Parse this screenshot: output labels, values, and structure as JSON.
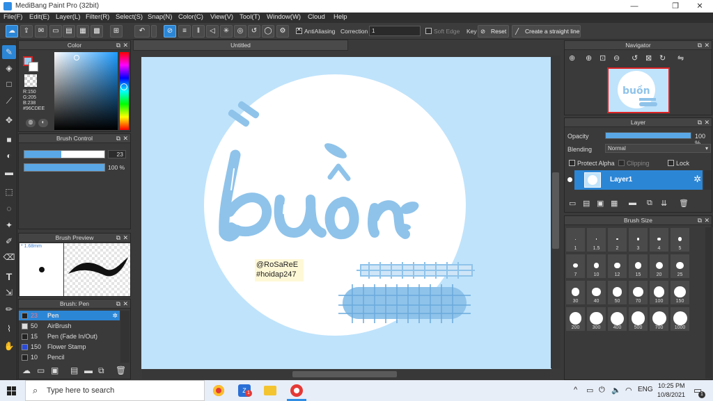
{
  "window": {
    "title": "MediBang Paint Pro (32bit)",
    "minimize": "—",
    "restore": "❐",
    "close": "✕"
  },
  "menu": [
    "File(F)",
    "Edit(E)",
    "Layer(L)",
    "Filter(R)",
    "Select(S)",
    "Snap(N)",
    "Color(C)",
    "View(V)",
    "Tool(T)",
    "Window(W)",
    "Cloud",
    "Help"
  ],
  "toolbar": {
    "antialiasing_label": "AntiAliasing",
    "correction_label": "Correction",
    "correction_value": "1",
    "soft_edge_label": "Soft Edge",
    "key_label": "Key",
    "reset_label": "Reset",
    "straight_line_label": "Create a straight line"
  },
  "color_panel": {
    "title": "Color",
    "r": "R:150",
    "g": "G:205",
    "b": "B:238",
    "hex": "#96CDEE",
    "fg_color": "#96cdee"
  },
  "brush_control": {
    "title": "Brush Control",
    "size_value": "23",
    "opacity_value": "100 %",
    "size_fraction": 0.46,
    "opacity_fraction": 1.0
  },
  "brush_preview": {
    "title": "Brush Preview",
    "size_label": "* 1.68mm"
  },
  "brush_list": {
    "title": "Brush: Pen",
    "items": [
      {
        "size": "23",
        "name": "Pen",
        "color": "#222222",
        "selected": true
      },
      {
        "size": "50",
        "name": "AirBrush",
        "color": "#dddddd",
        "selected": false
      },
      {
        "size": "15",
        "name": "Pen (Fade In/Out)",
        "color": "#222222",
        "selected": false
      },
      {
        "size": "150",
        "name": "Flower Stamp",
        "color": "#2a4ad8",
        "selected": false
      },
      {
        "size": "10",
        "name": "Pencil",
        "color": "#222222",
        "selected": false
      }
    ]
  },
  "document": {
    "tab_title": "Untitled"
  },
  "artwork": {
    "word": "buồn",
    "credit_line1": "@RoSaReE",
    "credit_line2": "#hoidap247",
    "bg_color": "#bfe3fb",
    "ink_color": "#8fc3ea"
  },
  "navigator": {
    "title": "Navigator"
  },
  "layer_panel": {
    "title": "Layer",
    "opacity_label": "Opacity",
    "opacity_value": "100 %",
    "opacity_fraction": 1.0,
    "blending_label": "Blending",
    "blending_value": "Normal",
    "protect_alpha_label": "Protect Alpha",
    "clipping_label": "Clipping",
    "lock_label": "Lock",
    "layer_name": "Layer1"
  },
  "brush_size_panel": {
    "title": "Brush Size",
    "sizes": [
      "1",
      "1.5",
      "2",
      "3",
      "4",
      "5",
      "7",
      "10",
      "12",
      "15",
      "20",
      "25",
      "30",
      "40",
      "50",
      "70",
      "100",
      "150",
      "200",
      "300",
      "400",
      "500",
      "700",
      "1000"
    ]
  },
  "taskbar": {
    "search_placeholder": "Type here to search",
    "lang": "ENG",
    "time": "10:25 PM",
    "date": "10/8/2021",
    "notif_count": "1"
  }
}
